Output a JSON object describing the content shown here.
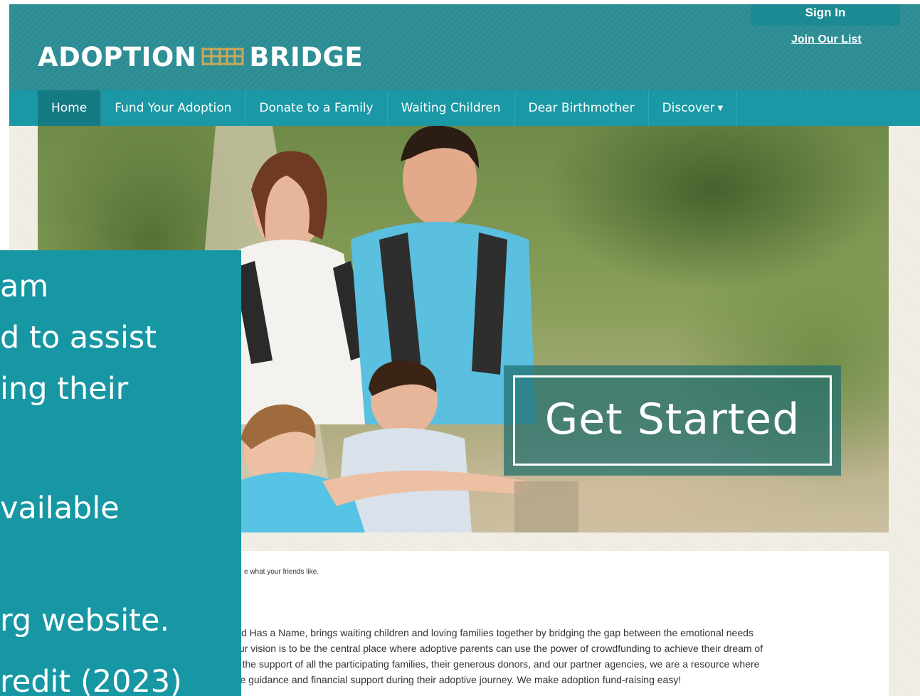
{
  "header": {
    "logo_left": "ADOPTION",
    "logo_right": "BRIDGE",
    "sign_in": "Sign In",
    "join_list": "Join Our List"
  },
  "nav": {
    "items": [
      {
        "label": "Home",
        "active": true
      },
      {
        "label": "Fund Your Adoption"
      },
      {
        "label": "Donate to a Family"
      },
      {
        "label": "Waiting Children"
      },
      {
        "label": "Dear Birthmother"
      },
      {
        "label": "Discover",
        "has_dropdown": true
      }
    ]
  },
  "hero": {
    "cta_label": "Get Started"
  },
  "content": {
    "friends_text": "e what your friends like.",
    "about_lines": [
      "hild Has a Name, brings waiting children and loving families together by bridging the gap between the emotional needs",
      "Our vision is to be the central place where adoptive parents can use the power of crowdfunding to achieve their dream of",
      "th the support of all the participating families, their generous donors, and our partner agencies, we are a resource where",
      "ure guidance and financial support during their adoptive journey.  We make adoption fund-raising easy!"
    ]
  },
  "overlay": {
    "lines": [
      "am",
      "d to assist",
      "ing their",
      "vailable",
      "rg website.",
      "redit (2023)"
    ]
  },
  "colors": {
    "header_bg": "#2b8c93",
    "nav_bg": "#1a98a5",
    "nav_active_bg": "#147a84",
    "overlay_bg": "#1797a3",
    "logo_accent": "#c9a85c"
  }
}
